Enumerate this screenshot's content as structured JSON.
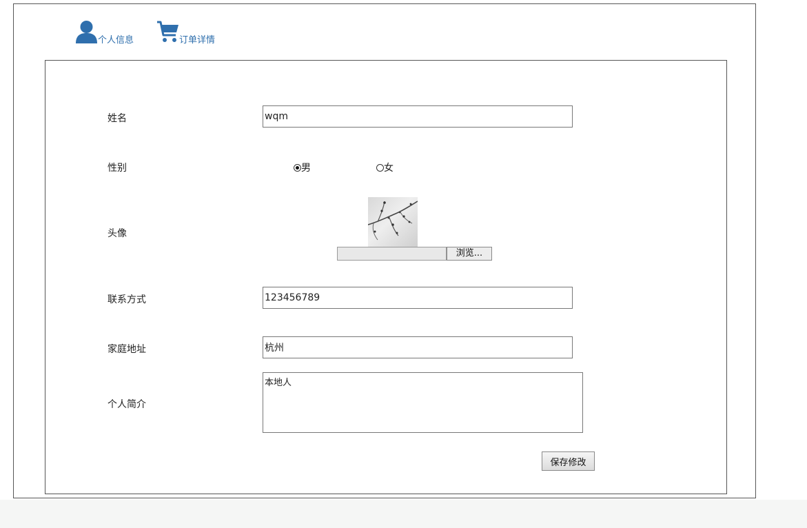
{
  "nav": {
    "profile": {
      "label": "个人信息",
      "icon": "user-icon"
    },
    "orders": {
      "label": "订单详情",
      "icon": "cart-icon"
    },
    "icon_color": "#2f6fad"
  },
  "form": {
    "name": {
      "label": "姓名",
      "value": "wqm"
    },
    "gender": {
      "label": "性别",
      "options": [
        "男",
        "女"
      ],
      "selected": "男"
    },
    "avatar": {
      "label": "头像",
      "browse_label": "浏览..."
    },
    "contact": {
      "label": "联系方式",
      "value": "123456789"
    },
    "address": {
      "label": "家庭地址",
      "value": "杭州"
    },
    "bio": {
      "label": "个人简介",
      "value": "本地人"
    },
    "save_label": "保存修改"
  }
}
